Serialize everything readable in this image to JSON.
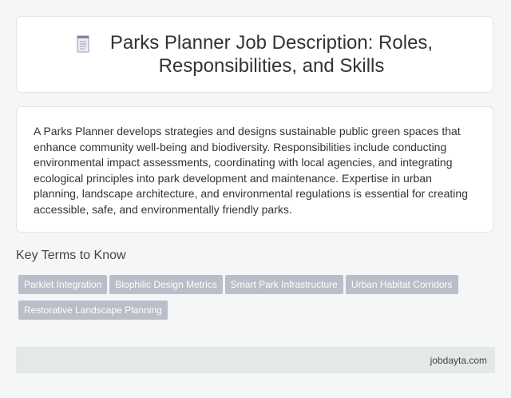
{
  "header": {
    "icon": "document-icon",
    "title_line1": "Parks Planner Job Description: Roles,",
    "title_line2": "Responsibilities, and Skills"
  },
  "description": "A Parks Planner develops strategies and designs sustainable public green spaces that enhance community well-being and biodiversity. Responsibilities include conducting environmental impact assessments, coordinating with local agencies, and integrating ecological principles into park development and maintenance. Expertise in urban planning, landscape architecture, and environmental regulations is essential for creating accessible, safe, and environmentally friendly parks.",
  "key_terms": {
    "heading": "Key Terms to Know",
    "tags": [
      "Parklet Integration",
      "Biophilic Design Metrics",
      "Smart Park Infrastructure",
      "Urban Habitat Corridors",
      "Restorative Landscape Planning"
    ]
  },
  "footer": {
    "site": "jobdayta.com"
  },
  "colors": {
    "tag_bg": "#b9bec8",
    "footer_bg": "#e4e9e8",
    "page_bg": "#f4f6f7"
  }
}
